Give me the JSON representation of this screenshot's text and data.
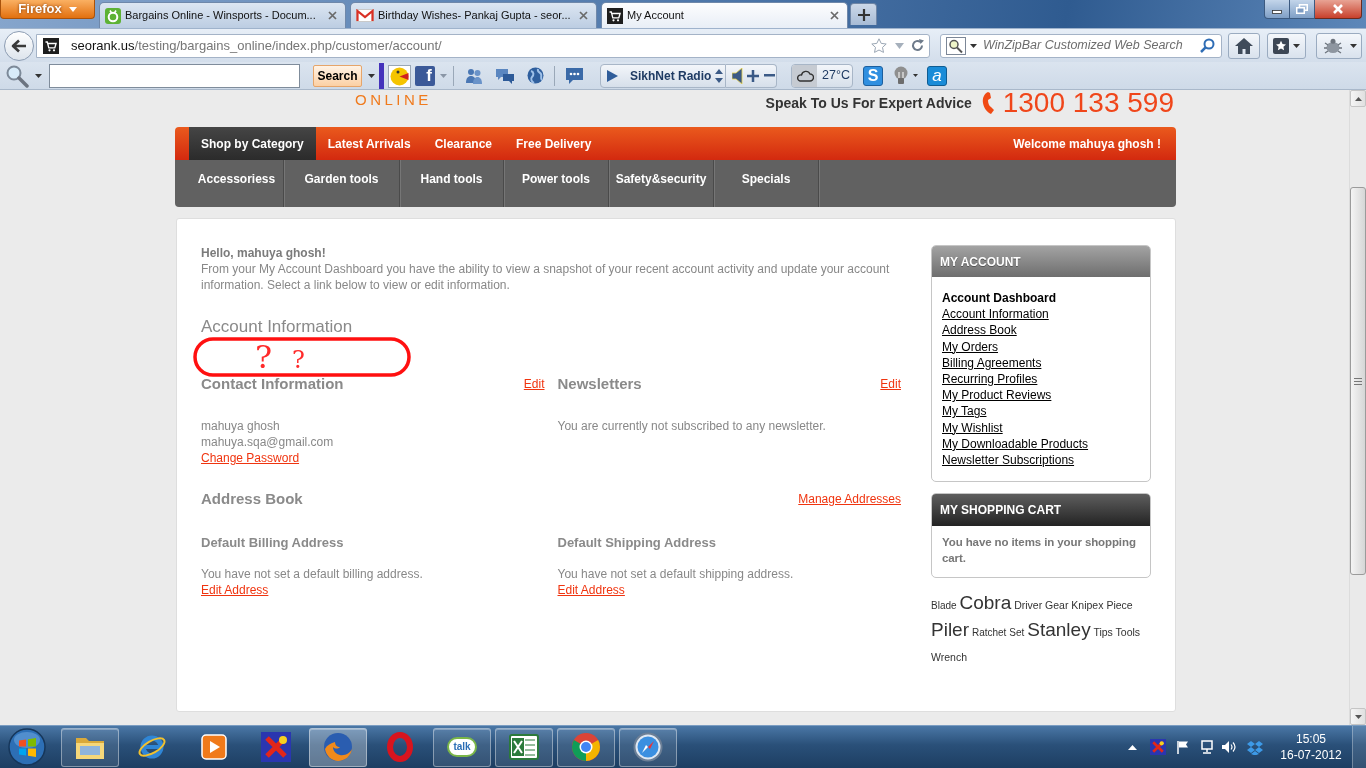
{
  "browser": {
    "menu_button": "Firefox",
    "tabs": [
      {
        "kind": "document",
        "title": "Bargains Online - Winsports - Docum...",
        "selected": false
      },
      {
        "kind": "mail",
        "title": "Birthday Wishes- Pankaj Gupta - seor...",
        "selected": false
      },
      {
        "kind": "shop",
        "title": "My Account",
        "selected": true
      }
    ],
    "address": {
      "host": "seorank.us",
      "path": "/testing/bargains_online/index.php/customer/account/"
    },
    "search": {
      "placeholder": "WinZipBar Customized Web Search"
    }
  },
  "toolbar": {
    "search_button": "Search",
    "f_button": "f",
    "radio": "SikhNet Radio",
    "weather": "27°C",
    "s_button": "S",
    "a_button": "a"
  },
  "header": {
    "logo": "ONLINE",
    "tagline": "Speak To Us For Expert Advice",
    "phone": "1300 133 599"
  },
  "nav": {
    "items": [
      {
        "label": "Shop by Category",
        "selected": true
      },
      {
        "label": "Latest Arrivals",
        "selected": false
      },
      {
        "label": "Clearance",
        "selected": false
      },
      {
        "label": "Free Delivery",
        "selected": false
      }
    ],
    "welcome": "Welcome mahuya ghosh !"
  },
  "categories": [
    "Accessoriess",
    "Garden tools",
    "Hand tools",
    "Power tools",
    "Safety&security",
    "Specials"
  ],
  "dashboard": {
    "greeting": "Hello, mahuya ghosh!",
    "intro": "From your My Account Dashboard you have the ability to view a snapshot of your recent account activity and update your account information. Select a link below to view or edit information.",
    "title": "Account Information",
    "annotation": {
      "marks": [
        "?",
        "?"
      ]
    },
    "contact": {
      "title": "Contact Information",
      "edit": "Edit",
      "name": "mahuya ghosh",
      "email": "mahuya.sqa@gmail.com",
      "link": "Change Password"
    },
    "newsletters": {
      "title": "Newsletters",
      "edit": "Edit",
      "text": "You are currently not subscribed to any newsletter."
    },
    "address_book": {
      "title": "Address Book",
      "link": "Manage Addresses",
      "columns": [
        {
          "title": "Default Billing Address",
          "text": "You have not set a default billing address.",
          "link": "Edit Address"
        },
        {
          "title": "Default Shipping Address",
          "text": "You have not set a default shipping address.",
          "link": "Edit Address"
        }
      ]
    }
  },
  "sidebar": {
    "account": {
      "title": "MY ACCOUNT",
      "items": [
        {
          "label": "Account Dashboard",
          "selected": true
        },
        {
          "label": "Account Information",
          "selected": false
        },
        {
          "label": "Address Book",
          "selected": false
        },
        {
          "label": "My Orders",
          "selected": false
        },
        {
          "label": "Billing Agreements",
          "selected": false
        },
        {
          "label": "Recurring Profiles",
          "selected": false
        },
        {
          "label": "My Product Reviews",
          "selected": false
        },
        {
          "label": "My Tags",
          "selected": false
        },
        {
          "label": "My Wishlist",
          "selected": false
        },
        {
          "label": "My Downloadable Products",
          "selected": false
        },
        {
          "label": "Newsletter Subscriptions",
          "selected": false
        }
      ]
    },
    "cart": {
      "title": "MY SHOPPING CART",
      "text": "You have no items in your shopping cart."
    },
    "tags": [
      {
        "label": "Blade",
        "kind": "small"
      },
      {
        "label": "Cobra",
        "kind": "large"
      },
      {
        "label": "Driver",
        "kind": "medium"
      },
      {
        "label": "Gear",
        "kind": "medium"
      },
      {
        "label": "Knipex",
        "kind": "medium"
      },
      {
        "label": "Piece",
        "kind": "medium"
      },
      {
        "label": "Piler",
        "kind": "large"
      },
      {
        "label": "Ratchet",
        "kind": "small"
      },
      {
        "label": "Set",
        "kind": "small"
      },
      {
        "label": "Stanley",
        "kind": "large"
      },
      {
        "label": "Tips",
        "kind": "medium"
      },
      {
        "label": "Tools",
        "kind": "medium"
      },
      {
        "label": "Wrench",
        "kind": "medium"
      }
    ]
  },
  "taskbar": {
    "apps": [
      {
        "kind": "explorer",
        "running": true,
        "selected": false
      },
      {
        "kind": "ie",
        "running": false,
        "selected": false
      },
      {
        "kind": "media",
        "running": false,
        "selected": false
      },
      {
        "kind": "cross",
        "running": false,
        "selected": false
      },
      {
        "kind": "firefox",
        "running": true,
        "selected": true
      },
      {
        "kind": "opera",
        "running": false,
        "selected": false
      },
      {
        "kind": "talk",
        "label": "talk",
        "running": true,
        "selected": false
      },
      {
        "kind": "excel",
        "running": true,
        "selected": false
      },
      {
        "kind": "chrome",
        "running": true,
        "selected": false
      },
      {
        "kind": "safari",
        "running": true,
        "selected": false
      }
    ],
    "time": "15:05",
    "date": "16-07-2012"
  }
}
